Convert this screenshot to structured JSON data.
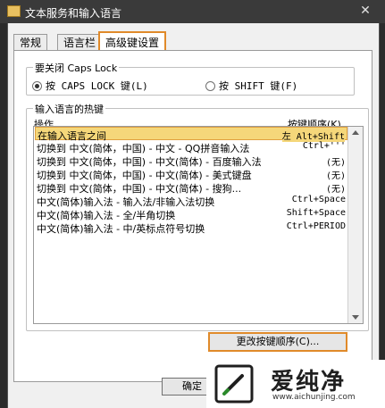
{
  "window": {
    "title": "文本服务和输入语言",
    "close_glyph": "✕"
  },
  "tabs": [
    {
      "label": "常规",
      "active": false
    },
    {
      "label": "语言栏",
      "active": false
    },
    {
      "label": "高级键设置",
      "active": true
    }
  ],
  "capslock_group": {
    "title": "要关闭 Caps Lock",
    "options": [
      {
        "label": "按 CAPS LOCK 键(L)",
        "selected": true
      },
      {
        "label": "按 SHIFT 键(F)",
        "selected": false
      }
    ]
  },
  "hotkeys_group": {
    "title": "输入语言的热键",
    "columns": {
      "action": "操作",
      "sequence": "按键顺序(K)"
    },
    "rows": [
      {
        "action": "在输入语言之间",
        "keys": "左 Alt+Shift",
        "selected": true
      },
      {
        "action": "切换到 中文(简体，中国) - 中文 - QQ拼音输入法",
        "keys": "Ctrl+'''",
        "selected": false
      },
      {
        "action": "切换到 中文(简体，中国) - 中文(简体) - 百度输入法",
        "keys": "(无)",
        "selected": false
      },
      {
        "action": "切换到 中文(简体，中国) - 中文(简体) - 美式键盘",
        "keys": "(无)",
        "selected": false
      },
      {
        "action": "切换到 中文(简体，中国) - 中文(简体) - 搜狗...",
        "keys": "(无)",
        "selected": false
      },
      {
        "action": "中文(简体)输入法 - 输入法/非输入法切换",
        "keys": "Ctrl+Space",
        "selected": false
      },
      {
        "action": "中文(简体)输入法 - 全/半角切换",
        "keys": "Shift+Space",
        "selected": false
      },
      {
        "action": "中文(简体)输入法 - 中/英标点符号切换",
        "keys": "Ctrl+PERIOD",
        "selected": false
      }
    ],
    "change_button": "更改按键顺序(C)..."
  },
  "buttons": {
    "ok": "确定"
  },
  "watermark": {
    "brand": "爱纯净",
    "url": "www.aichunjing.com"
  },
  "colors": {
    "highlight": "#e08a2a",
    "selection": "#f5d77a"
  }
}
